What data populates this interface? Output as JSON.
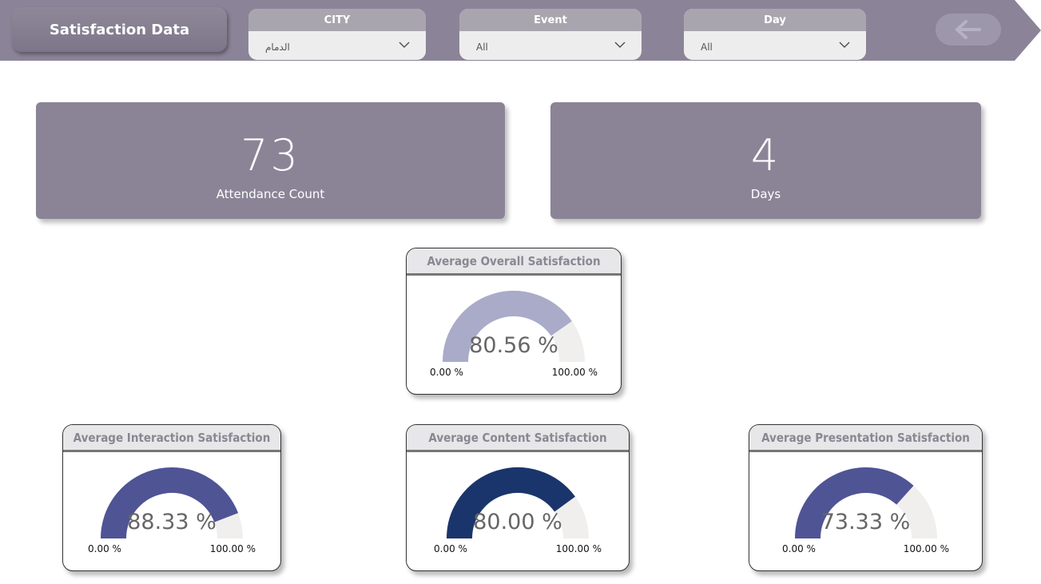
{
  "header": {
    "title": "Satisfaction Data",
    "slicers": [
      {
        "label": "CITY",
        "value": "الدمام"
      },
      {
        "label": "Event",
        "value": "All"
      },
      {
        "label": "Day",
        "value": "All"
      }
    ],
    "back_icon": "arrow-left-icon"
  },
  "cards": [
    {
      "value": "73",
      "label": "Attendance Count"
    },
    {
      "value": "4",
      "label": "Days"
    }
  ],
  "gauges": {
    "overall": {
      "title": "Average Overall Satisfaction",
      "value_text": "80.56 %",
      "value": 80.56,
      "min": "0.00 %",
      "max": "100.00 %",
      "color": "#a9abc9"
    },
    "interaction": {
      "title": "Average Interaction Satisfaction",
      "value_text": "88.33 %",
      "value": 88.33,
      "min": "0.00 %",
      "max": "100.00 %",
      "color": "#4f5495"
    },
    "content": {
      "title": "Average Content Satisfaction",
      "value_text": "80.00 %",
      "value": 80.0,
      "min": "0.00 %",
      "max": "100.00 %",
      "color": "#1a356b"
    },
    "presentation": {
      "title": "Average Presentation Satisfaction",
      "value_text": "73.33 %",
      "value": 73.33,
      "min": "0.00 %",
      "max": "100.00 %",
      "color": "#4f5495"
    }
  },
  "colors": {
    "header_bg": "#8b8498",
    "card_bg": "#8b8497",
    "gauge_track": "#f0efee"
  }
}
